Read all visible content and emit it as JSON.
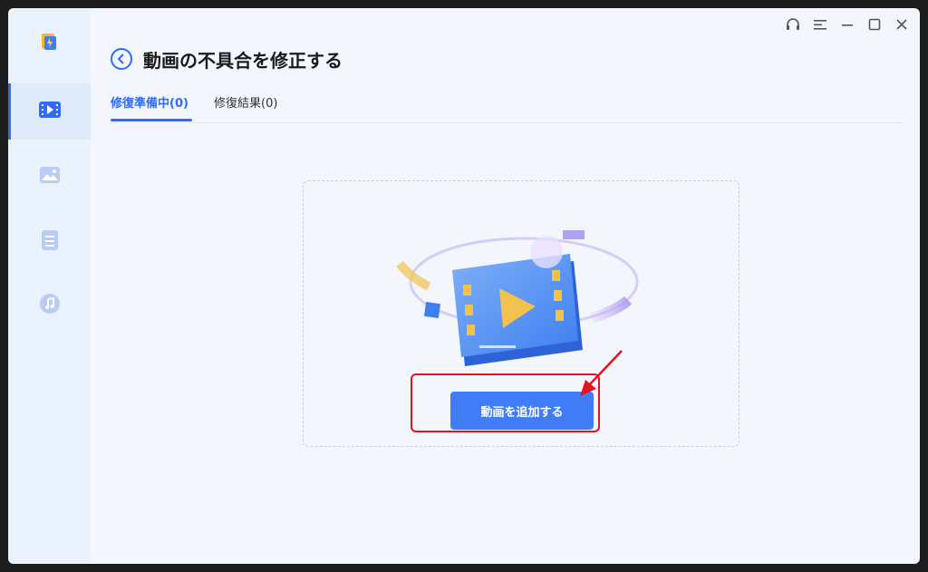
{
  "header": {
    "title": "動画の不具合を修正する"
  },
  "tabs": [
    {
      "label": "修復準備中(0)",
      "active": true
    },
    {
      "label": "修復結果(0)",
      "active": false
    }
  ],
  "main": {
    "add_button_label": "動画を追加する"
  },
  "sidebar": {
    "items": [
      {
        "icon": "video-icon",
        "active": true
      },
      {
        "icon": "image-icon",
        "active": false
      },
      {
        "icon": "document-icon",
        "active": false
      },
      {
        "icon": "music-icon",
        "active": false
      }
    ]
  },
  "window_controls": [
    "headset-icon",
    "menu-icon",
    "minimize-icon",
    "maximize-icon",
    "close-icon"
  ],
  "colors": {
    "accent": "#2f6bf3",
    "button": "#3f7cf6",
    "highlight": "#e3141b",
    "sidebar": "#e9f2fd",
    "background": "#f3f7fd"
  }
}
